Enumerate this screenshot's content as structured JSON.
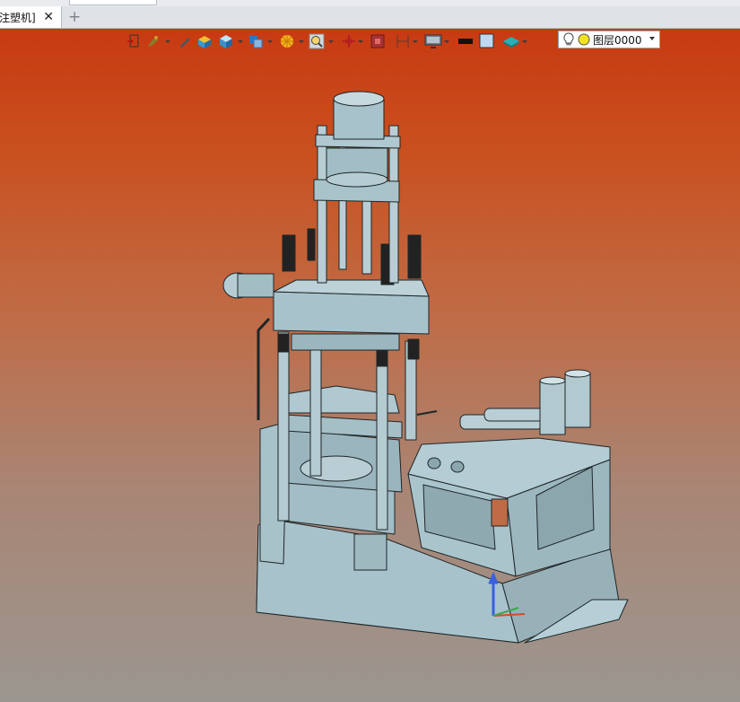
{
  "tabs": [
    {
      "title": "注塑机]",
      "close_glyph": "✕"
    }
  ],
  "new_tab_glyph": "+",
  "viewport": {
    "background_top": "#c83a12",
    "background_bottom": "#9b9690",
    "model_color": "#a6c1c9"
  },
  "toolbar": {
    "icons": [
      "view-front-icon",
      "fit-view-icon",
      "pen-icon",
      "shaded-cube-icon",
      "display-mode-cube-icon",
      "view-orientation-icon",
      "section-view-icon",
      "zoom-icon",
      "pan-icon",
      "render-icon",
      "dimension-icon",
      "monitor-icon",
      "line-color-swatch",
      "fill-color-swatch",
      "layer-display-icon"
    ],
    "layer_selector": {
      "value": "图层0000"
    }
  }
}
